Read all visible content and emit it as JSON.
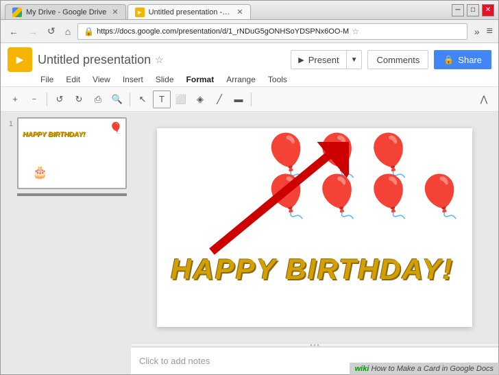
{
  "window": {
    "tabs": [
      {
        "id": "drive",
        "label": "My Drive - Google Drive",
        "favicon": "drive",
        "active": false
      },
      {
        "id": "slides",
        "label": "Untitled presentation - Go",
        "favicon": "slides",
        "active": true
      }
    ],
    "close_label": "✕",
    "minimize_label": "─",
    "maximize_label": "□"
  },
  "address_bar": {
    "back_label": "←",
    "forward_label": "→",
    "reload_label": "↺",
    "home_label": "⌂",
    "url": "https://docs.google.com/presentation/d/1_rNDuG5gONHSoYDSPNx6OO-M",
    "star_label": "☆",
    "more_label": "»",
    "menu_label": "≡"
  },
  "app_header": {
    "logo_text": "►",
    "doc_title": "Untitled presentation",
    "star_icon": "☆",
    "present_label": "Present",
    "present_icon": "▶",
    "present_dropdown": "▼",
    "comments_label": "Comments",
    "share_label": "Share",
    "share_icon": "🔒"
  },
  "menu_bar": {
    "items": [
      "File",
      "Edit",
      "View",
      "Insert",
      "Slide",
      "Format",
      "Arrange",
      "Tools"
    ]
  },
  "toolbar": {
    "buttons": [
      "+",
      "−",
      "↺",
      "↻",
      "⎙",
      "🔍",
      "↖",
      "T",
      "⬜",
      "◈",
      "╱",
      "▬"
    ],
    "expand_label": "⋀"
  },
  "slide_panel": {
    "slide_number": "1"
  },
  "slide": {
    "happy_birthday_text": "HAPPY BIRTHDAY!",
    "balloons_emoji": "🎈",
    "cake_emoji": "🎂"
  },
  "notes": {
    "placeholder": "Click to add notes"
  },
  "wikihow": {
    "logo": "wiki",
    "text": "How to Make a Card in Google Docs"
  }
}
